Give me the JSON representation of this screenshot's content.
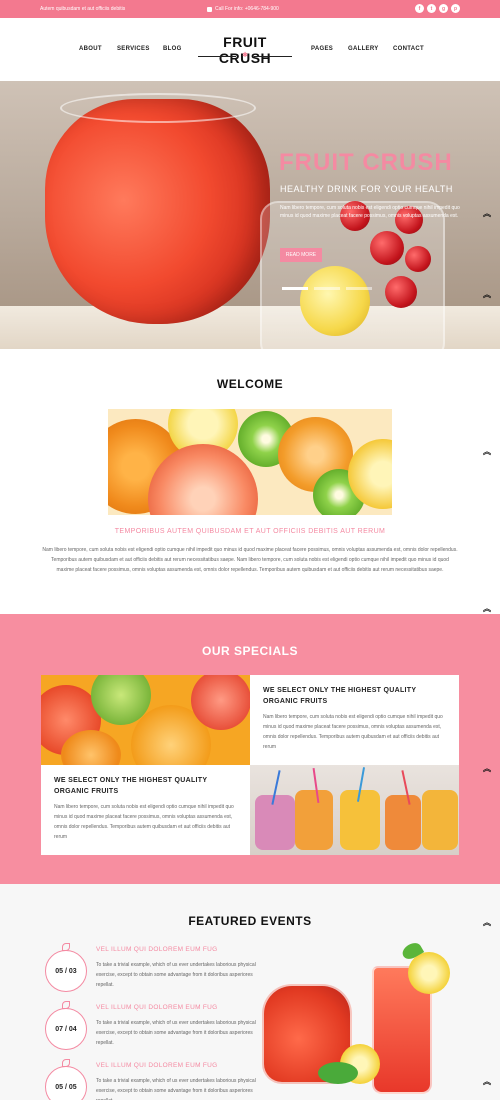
{
  "topbar": {
    "tagline": "Autem quibusdam et aut officiis debitis",
    "call": "Call For info: +0646-784-900",
    "social": [
      "f",
      "t",
      "g",
      "p"
    ]
  },
  "nav": {
    "left": [
      "ABOUT",
      "SERVICES",
      "BLOG"
    ],
    "right": [
      "PAGES",
      "GALLERY",
      "CONTACT"
    ],
    "logo": "FRUIT CRUSH"
  },
  "hero": {
    "title": "FRUIT CRUSH",
    "subtitle": "HEALTHY DRINK FOR YOUR HEALTH",
    "desc": "Nam libero tempore, cum soluta nobis est eligendi optio cumque nihil impedit quo minus id quod maxime placeat facere possimus, omnis voluptas assumenda est.",
    "button": "READ MORE",
    "slides": 3
  },
  "welcome": {
    "title": "WELCOME",
    "heading": "TEMPORIBUS AUTEM QUIBUSDAM ET AUT OFFICIIS DEBITIS AUT RERUM",
    "text": "Nam libero tempore, cum soluta nobis est eligendi optio cumque nihil impedit quo minus id quod maxime placeat facere possimus, omnis voluptas assumenda est, omnis dolor repellendus. Temporibus autem quibusdam et aut officiis debitis aut rerum necessitatibus saepe. Nam libero tempore, cum soluta nobis est eligendi optio cumque nihil impedit quo minus id quod maxime placeat facere possimus, omnis voluptas assumenda est, omnis dolor repellendus. Temporibus autem quibusdam et aut officiis debitis aut rerum necessitatibus saepe."
  },
  "specials": {
    "title": "OUR SPECIALS",
    "card1_heading": "WE SELECT ONLY THE HIGHEST QUALITY ORGANIC FRUITS",
    "card1_text": "Nam libero tempore, cum soluta nobis est eligendi optio cumque nihil impedit quo minus id quod maxime placeat facere possimus, omnis voluptas assumenda est, omnis dolor repellendus. Temporibus autem quibusdam et aut officiis debitis aut rerum",
    "card2_heading": "WE SELECT ONLY THE HIGHEST QUALITY ORGANIC FRUITS",
    "card2_text": "Nam libero tempore, cum soluta nobis est eligendi optio cumque nihil impedit quo minus id quod maxime placeat facere possimus, omnis voluptas assumenda est, omnis dolor repellendus. Temporibus autem quibusdam et aut officiis debitis aut rerum"
  },
  "events": {
    "title": "FEATURED EVENTS",
    "items": [
      {
        "date": "05 / 03",
        "heading": "VEL ILLUM QUI DOLOREM EUM FUG",
        "text": "To take a trivial example, which of us ever undertakes laborious physical exercise, except to obtain some advantage from it doloribus asperiores repellat."
      },
      {
        "date": "07 / 04",
        "heading": "VEL ILLUM QUI DOLOREM EUM FUG",
        "text": "To take a trivial example, which of us ever undertakes laborious physical exercise, except to obtain some advantage from it doloribus asperiores repellat."
      },
      {
        "date": "05 / 05",
        "heading": "VEL ILLUM QUI DOLOREM EUM FUG",
        "text": "To take a trivial example, which of us ever undertakes laborious physical exercise, except to obtain some advantage from it doloribus asperiores repellat."
      }
    ]
  },
  "colors": {
    "accent": "#f48aa2",
    "topbar": "#f3798f",
    "specials_bg": "#f78ea0"
  },
  "icons": [
    "phone-icon",
    "facebook-icon",
    "twitter-icon",
    "google-plus-icon",
    "pinterest-icon",
    "leaf-icon",
    "double-chevron-up-icon"
  ]
}
